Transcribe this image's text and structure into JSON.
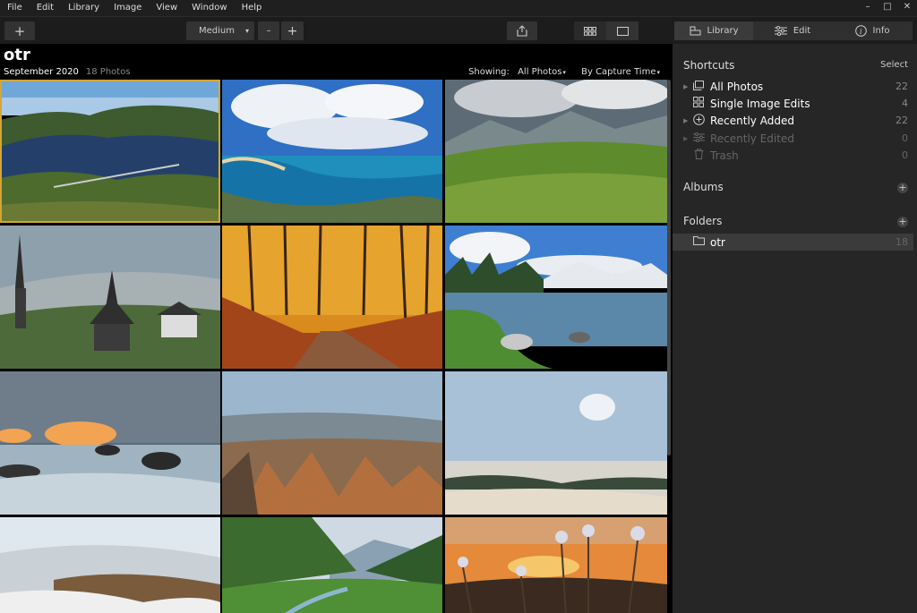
{
  "menubar": {
    "items": [
      "File",
      "Edit",
      "Library",
      "Image",
      "View",
      "Window",
      "Help"
    ],
    "minimize": "–",
    "maximize": "□",
    "close": "✕"
  },
  "toolbar": {
    "add": "+",
    "size_label": "Medium",
    "dropdown": "▾",
    "zoom_out": "–",
    "zoom_in": "+",
    "share_icon": "share-icon",
    "grid_icon": "grid-view-icon",
    "single_icon": "single-view-icon",
    "tab_library": "Library",
    "tab_edit": "Edit",
    "tab_info": "Info"
  },
  "album": {
    "title": "otr",
    "date": "September 2020",
    "count": "18 Photos",
    "showing_label": "Showing:",
    "showing_value": "All Photos",
    "sort_value": "By Capture Time"
  },
  "panel": {
    "shortcuts_title": "Shortcuts",
    "select_label": "Select",
    "shortcuts": [
      {
        "label": "All Photos",
        "count": "22",
        "icon": "photos-icon",
        "enabled": true
      },
      {
        "label": "Single Image Edits",
        "count": "4",
        "icon": "grid-icon",
        "enabled": true
      },
      {
        "label": "Recently Added",
        "count": "22",
        "icon": "plus-circle-icon",
        "enabled": true
      },
      {
        "label": "Recently Edited",
        "count": "0",
        "icon": "sliders-icon",
        "enabled": false
      },
      {
        "label": "Trash",
        "count": "0",
        "icon": "trash-icon",
        "enabled": false
      }
    ],
    "albums_title": "Albums",
    "folders_title": "Folders",
    "folder": {
      "label": "otr",
      "count": "18"
    }
  },
  "colors": {
    "selection": "#d3a636",
    "panel_bg": "#262626",
    "accent_bg": "#3b3b3b"
  }
}
